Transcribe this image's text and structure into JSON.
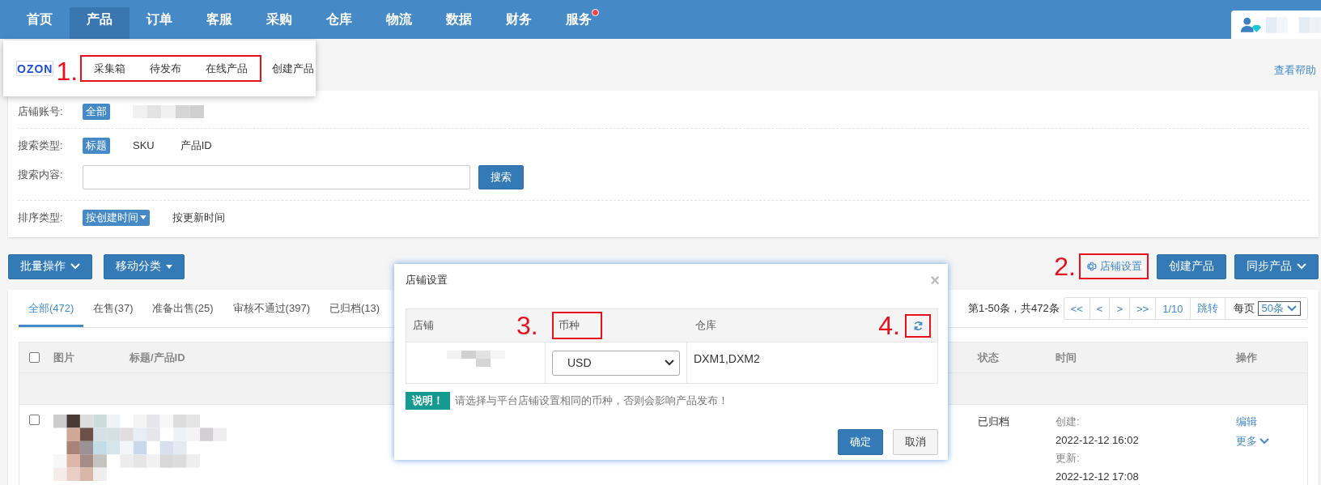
{
  "nav": {
    "items": [
      {
        "label": "首页",
        "selected": false,
        "badge": false
      },
      {
        "label": "产品",
        "selected": true,
        "badge": false
      },
      {
        "label": "订单",
        "selected": false,
        "badge": false
      },
      {
        "label": "客服",
        "selected": false,
        "badge": false
      },
      {
        "label": "采购",
        "selected": false,
        "badge": false
      },
      {
        "label": "仓库",
        "selected": false,
        "badge": false
      },
      {
        "label": "物流",
        "selected": false,
        "badge": false
      },
      {
        "label": "数据",
        "selected": false,
        "badge": false
      },
      {
        "label": "财务",
        "selected": false,
        "badge": false
      },
      {
        "label": "服务",
        "selected": false,
        "badge": true
      }
    ],
    "user": {
      "kind": "picture"
    }
  },
  "menu": {
    "logo": "OZON",
    "annotation": "1.",
    "highlighted_items": [
      "采集箱",
      "待发布",
      "在线产品"
    ],
    "items": [
      "创建产品"
    ]
  },
  "help_link": "查看帮助",
  "filters": [
    {
      "kind": "options",
      "label": "店铺账号:",
      "value": {
        "kind": "picture"
      },
      "options": [
        {
          "label": "全部",
          "selected": true
        }
      ]
    },
    {
      "kind": "options",
      "label": "搜索类型:",
      "options": [
        {
          "label": "标题",
          "selected": true
        },
        {
          "label": "SKU",
          "selected": false
        },
        {
          "label": "产品ID",
          "selected": false
        }
      ]
    },
    {
      "kind": "search",
      "label": "搜索内容:",
      "button": "搜索"
    },
    {
      "kind": "options",
      "label": "排序类型:",
      "options": [
        {
          "label": "按创建时间",
          "selected": true,
          "caret": true
        },
        {
          "label": "按更新时间",
          "selected": false
        }
      ]
    }
  ],
  "toolbar": {
    "left": [
      {
        "label": "批量操作",
        "kind": "chevron"
      },
      {
        "label": "移动分类",
        "kind": "triangle"
      }
    ],
    "right": [
      {
        "kind": "link",
        "label": "店铺设置",
        "annotation": "2."
      },
      {
        "kind": "button",
        "label": "创建产品"
      },
      {
        "kind": "chevron",
        "label": "同步产品"
      }
    ]
  },
  "tabs": [
    {
      "label": "全部(472)",
      "selected": true
    },
    {
      "label": "在售(37)",
      "selected": false
    },
    {
      "label": "准备出售(25)",
      "selected": false
    },
    {
      "label": "审核不通过(397)",
      "selected": false
    },
    {
      "label": "已归档(13)",
      "selected": false
    }
  ],
  "pagination": {
    "summary": "第1-50条，共472条",
    "buttons": [
      "<<",
      "<",
      ">",
      ">>"
    ],
    "page": "1/10",
    "jump": "跳转",
    "per_page_label": "每页",
    "per_page": "50条"
  },
  "table": {
    "select_all": false,
    "columns": [
      "图片",
      "标题/产品ID",
      "状态",
      "时间",
      "操作"
    ],
    "rows": [
      {
        "checked": false,
        "image": {
          "kind": "picture"
        },
        "status": "已归档",
        "time": [
          "创建:",
          "2022-12-12 16:02",
          "更新:",
          "2022-12-12 17:08"
        ],
        "actions": [
          {
            "label": "编辑"
          },
          {
            "label": "更多",
            "caret": true
          }
        ]
      }
    ]
  },
  "modal": {
    "title": "店铺设置",
    "close": "×",
    "columns": [
      {
        "label": "店铺"
      },
      {
        "label": "币种",
        "annotation": "3."
      },
      {
        "label": "仓库"
      }
    ],
    "refresh_annotation": "4.",
    "rows": [
      {
        "store": {
          "kind": "picture"
        },
        "currency": "USD",
        "warehouse": "DXM1,DXM2"
      }
    ],
    "note_badge": "说明！",
    "note": "请选择与平台店铺设置相同的币种，否则会影响产品发布！",
    "buttons": [
      {
        "label": "确定",
        "kind": "primary"
      },
      {
        "label": "取消",
        "kind": "default"
      }
    ]
  }
}
